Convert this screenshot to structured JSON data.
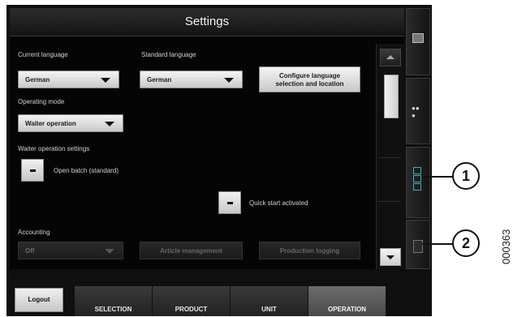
{
  "title": "Settings",
  "language": {
    "current_label": "Current language",
    "current_value": "German",
    "standard_label": "Standard language",
    "standard_value": "German",
    "configure_line1": "Configure language",
    "configure_line2": "selection and location"
  },
  "operating_mode": {
    "label": "Operating mode",
    "value": "Waiter operation"
  },
  "waiter_settings": {
    "label": "Waiter operation settings",
    "open_batch": "Open batch (standard)"
  },
  "quick_start": "Quick start activated",
  "accounting": {
    "label": "Accounting",
    "value": "Off",
    "article_button": "Article management",
    "production_button": "Production logging"
  },
  "bottom": {
    "logout": "Logout",
    "tabs": [
      "SELECTION",
      "PRODUCT",
      "UNIT",
      "OPERATION"
    ],
    "active_tab": "OPERATION"
  },
  "callouts": [
    "1",
    "2"
  ],
  "figure_code": "000363"
}
